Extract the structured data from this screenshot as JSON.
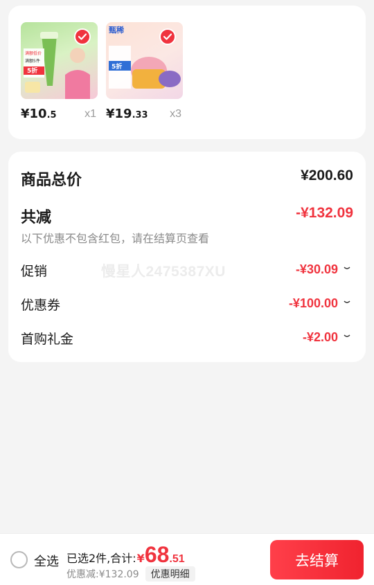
{
  "products": [
    {
      "price_int": "¥10",
      "price_dec": ".5",
      "qty": "x1",
      "image_text": [
        "满额低价",
        "满额5件",
        "5折"
      ]
    },
    {
      "price_int": "¥19",
      "price_dec": ".33",
      "qty": "x3",
      "image_text": [
        "甄稀",
        "5折"
      ]
    }
  ],
  "summary": {
    "total_label": "商品总价",
    "total_value": "¥200.60",
    "reduce_label": "共减",
    "reduce_value": "-¥132.09",
    "note": "以下优惠不包含红包，请在结算页查看",
    "items": [
      {
        "label": "促销",
        "value": "-¥30.09"
      },
      {
        "label": "优惠券",
        "value": "-¥100.00"
      },
      {
        "label": "首购礼金",
        "value": "-¥2.00"
      }
    ],
    "watermark": "慢星人2475387XU"
  },
  "bottom": {
    "select_all": "全选",
    "selected_text": "已选2件,合计:",
    "yen": "¥",
    "total_int": "68",
    "total_dec": ".51",
    "discount_text": "优惠减:¥132.09",
    "detail_label": "优惠明细",
    "checkout_label": "去结算"
  },
  "colors": {
    "accent": "#f0333e",
    "page_bg": "#f4f4f4"
  }
}
